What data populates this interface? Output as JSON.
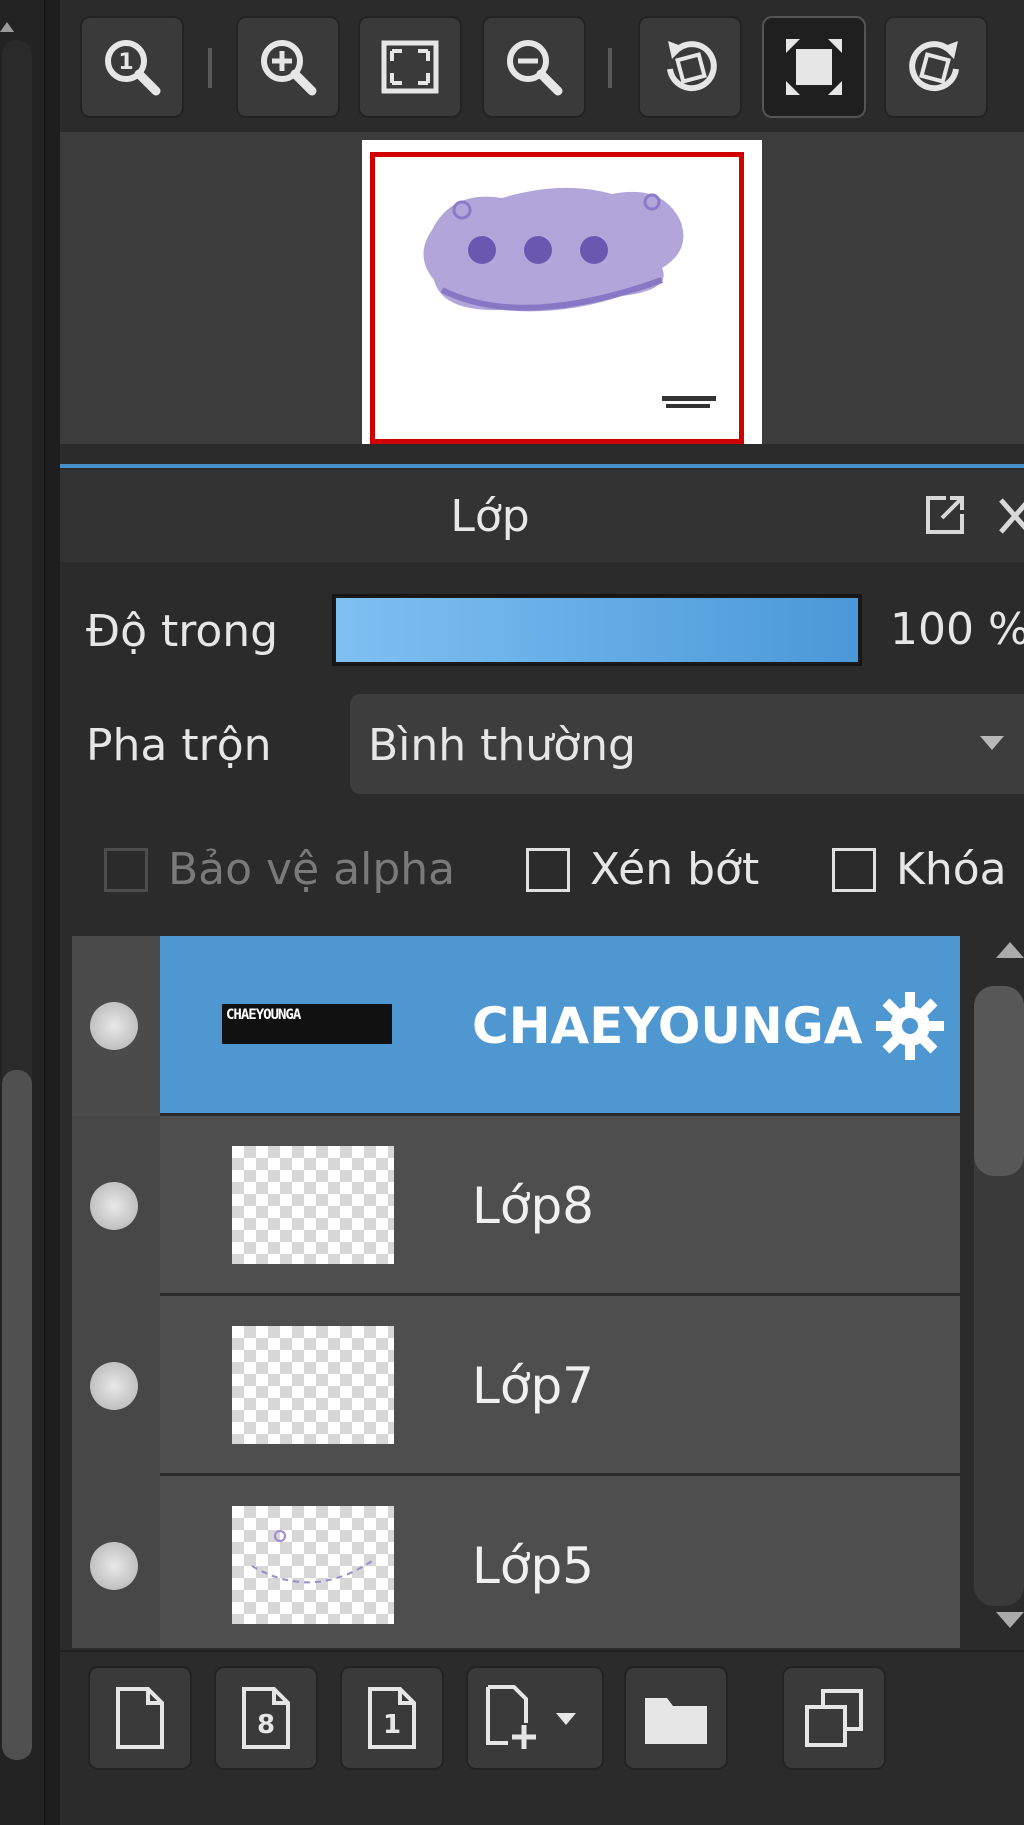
{
  "toolbar": {
    "buttons": [
      {
        "name": "actual-size-icon"
      },
      {
        "name": "zoom-in-icon"
      },
      {
        "name": "fit-screen-icon"
      },
      {
        "name": "zoom-out-icon"
      },
      {
        "name": "rotate-left-icon"
      },
      {
        "name": "fullscreen-icon"
      },
      {
        "name": "rotate-right-icon"
      }
    ]
  },
  "layer_panel": {
    "title": "Lớp",
    "opacity_label": "Độ trong",
    "opacity_value": "100 %",
    "opacity_fraction": 1.0,
    "blend_label": "Pha trộn",
    "blend_value": "Bình thường",
    "checks": [
      {
        "label": "Bảo vệ alpha",
        "checked": false,
        "disabled": true
      },
      {
        "label": "Xén bớt",
        "checked": false,
        "disabled": false
      },
      {
        "label": "Khóa",
        "checked": false,
        "disabled": false
      }
    ],
    "layers": [
      {
        "name": "CHAEYOUNGA",
        "selected": true,
        "thumb_text": "CHAEYOUNGA"
      },
      {
        "name": "Lớp8",
        "selected": false
      },
      {
        "name": "Lớp7",
        "selected": false
      },
      {
        "name": "Lớp5",
        "selected": false
      }
    ]
  },
  "bottom_toolbar": {
    "buttons": [
      {
        "name": "new-layer-icon"
      },
      {
        "name": "new-8bit-layer-icon",
        "glyph": "8"
      },
      {
        "name": "new-1bit-layer-icon",
        "glyph": "1"
      },
      {
        "name": "add-layer-menu-icon"
      },
      {
        "name": "folder-icon"
      },
      {
        "name": "duplicate-layer-icon"
      }
    ]
  },
  "colors": {
    "accent": "#4f97d1",
    "selection_frame": "#d00000",
    "panel_bg": "#2b2b2b"
  }
}
